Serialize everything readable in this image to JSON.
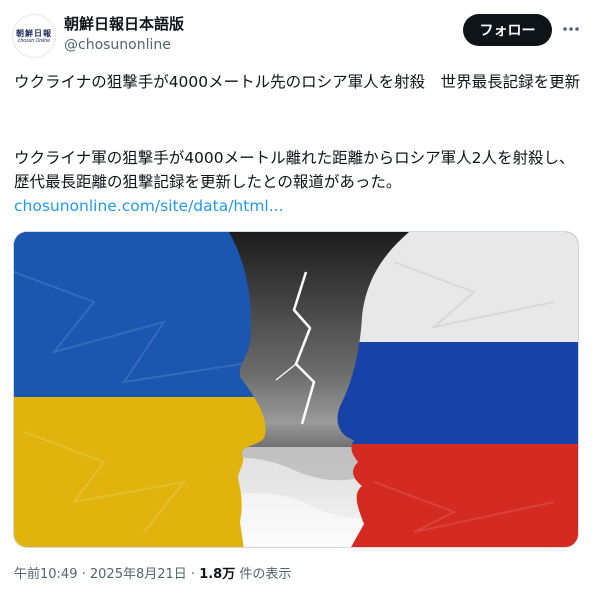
{
  "account": {
    "name": "朝鮮日報日本語版",
    "handle": "@chosunonline",
    "avatar_logo_cjk": "朝鮮日報",
    "avatar_logo_latin": "chosun Online"
  },
  "follow_label": "フォロー",
  "more_icon": "more-horizontal-icon",
  "post": {
    "headline": "ウクライナの狙撃手が4000メートル先のロシア軍人を射殺　世界最長記録を更新",
    "body": "ウクライナ軍の狙撃手が4000メートル離れた距離からロシア軍人2人を射殺し、歴代最長距離の狙撃記録を更新したとの報道があった。",
    "link": "chosunonline.com/site/data/html..."
  },
  "meta": {
    "time": "午前10:49",
    "sep1": " · ",
    "date": "2025年8月21日",
    "sep2": " · ",
    "views": "1.8万",
    "views_suffix": " 件の表示"
  },
  "colors": {
    "ukraine_blue": "#1b57b0",
    "ukraine_yellow": "#e0b40d",
    "russia_white": "#e8e8e8",
    "russia_blue": "#1743a8",
    "russia_red": "#d42a22",
    "link": "#1d9bf0"
  }
}
